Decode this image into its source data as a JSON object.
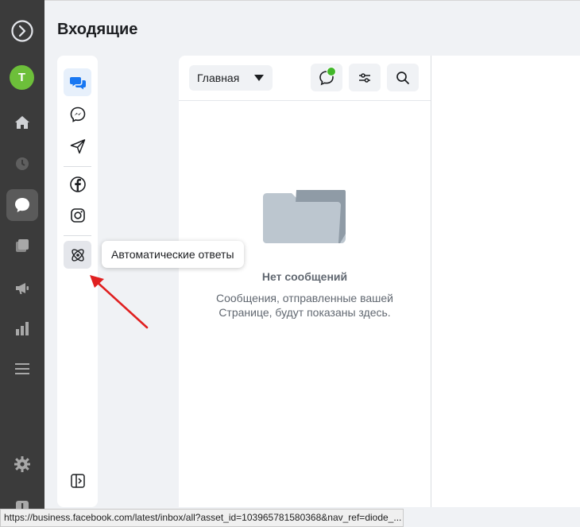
{
  "page": {
    "title": "Входящие"
  },
  "user": {
    "avatar_initial": "T",
    "avatar_color": "#6dbf3a"
  },
  "rail": {
    "items": [
      {
        "icon": "meta-logo-icon"
      },
      {
        "icon": "home-icon"
      },
      {
        "icon": "activity-clock-icon"
      },
      {
        "icon": "inbox-chat-icon",
        "active": true
      },
      {
        "icon": "content-pages-icon"
      },
      {
        "icon": "ads-megaphone-icon"
      },
      {
        "icon": "insights-chart-icon"
      },
      {
        "icon": "menu-icon"
      },
      {
        "icon": "settings-gear-icon"
      },
      {
        "icon": "alert-icon"
      }
    ]
  },
  "subnav": {
    "items": [
      {
        "icon": "all-messages-icon",
        "active": true
      },
      {
        "icon": "messenger-icon"
      },
      {
        "icon": "send-icon"
      },
      {
        "icon": "facebook-icon"
      },
      {
        "icon": "instagram-icon"
      },
      {
        "icon": "automated-responses-icon",
        "hovered": true
      },
      {
        "icon": "collapse-panel-icon"
      }
    ]
  },
  "tooltip": {
    "text": "Автоматические ответы"
  },
  "toolbar": {
    "filter_selected": "Главная",
    "has_unread_dot": true
  },
  "empty_state": {
    "title": "Нет сообщений",
    "description_line1": "Сообщения, отправленные вашей",
    "description_line2": "Странице, будут показаны здесь."
  },
  "statusbar": {
    "url": "https://business.facebook.com/latest/inbox/all?asset_id=103965781580368&nav_ref=diode_..."
  },
  "colors": {
    "rail_bg": "#3b3b3b",
    "accent_blue": "#1877f2",
    "online_green": "#42b72a",
    "annotation_arrow": "#e02020"
  }
}
